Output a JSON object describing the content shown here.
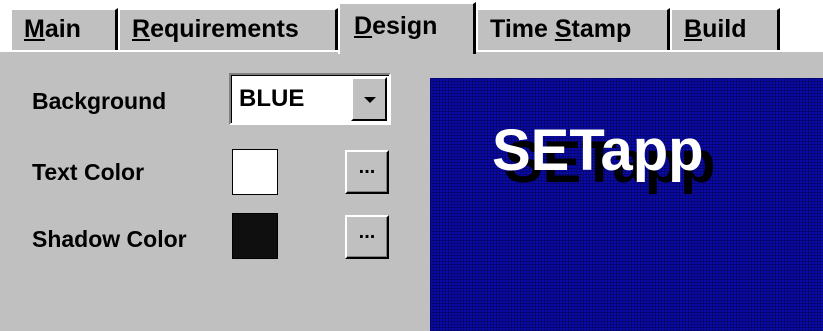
{
  "tabs": [
    {
      "pre": "",
      "acc": "M",
      "post": "ain"
    },
    {
      "pre": "",
      "acc": "R",
      "post": "equirements"
    },
    {
      "pre": "",
      "acc": "D",
      "post": "esign"
    },
    {
      "pre": "Time ",
      "acc": "S",
      "post": "tamp"
    },
    {
      "pre": "",
      "acc": "B",
      "post": "uild"
    }
  ],
  "active_tab": "Design",
  "design": {
    "background_label": "Background",
    "background_value": "BLUE",
    "text_color_label": "Text Color",
    "shadow_color_label": "Shadow Color",
    "ellipsis": "..."
  },
  "preview": {
    "text": "SETapp"
  },
  "colors": {
    "text": "#ffffff",
    "shadow": "#000000",
    "background": "#0a0aa8"
  }
}
